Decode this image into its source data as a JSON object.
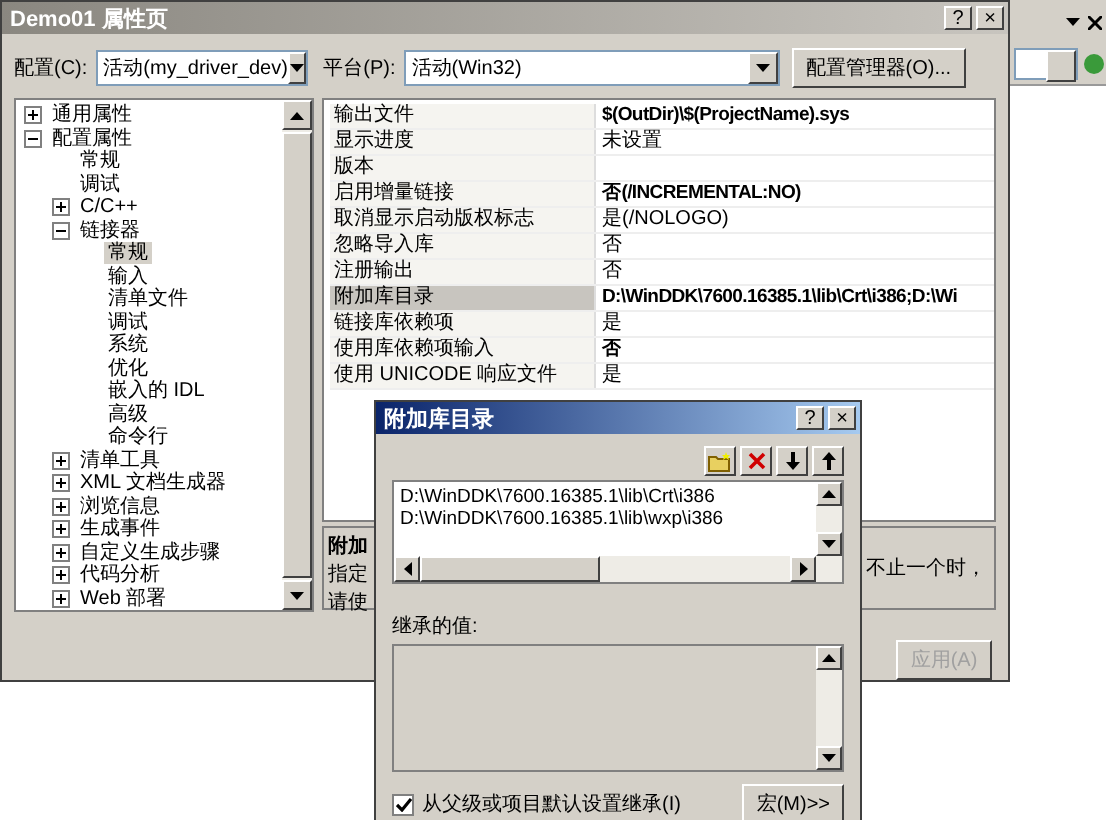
{
  "main_window": {
    "title": "Demo01 属性页",
    "help": "?",
    "close": "×",
    "config": {
      "label": "配置(C):",
      "value": "活动(my_driver_dev)"
    },
    "platform": {
      "label": "平台(P):",
      "value": "活动(Win32)"
    },
    "manager_button": "配置管理器(O)...",
    "tree": [
      {
        "label": "通用属性",
        "expanded": false,
        "selected": false
      },
      {
        "label": "配置属性",
        "expanded": true,
        "selected": false,
        "children": [
          {
            "label": "常规",
            "selected": false
          },
          {
            "label": "调试",
            "selected": false
          },
          {
            "label": "C/C++",
            "expanded": false,
            "selected": false
          },
          {
            "label": "链接器",
            "expanded": true,
            "selected": false,
            "children": [
              {
                "label": "常规",
                "selected": true
              },
              {
                "label": "输入",
                "selected": false
              },
              {
                "label": "清单文件",
                "selected": false
              },
              {
                "label": "调试",
                "selected": false
              },
              {
                "label": "系统",
                "selected": false
              },
              {
                "label": "优化",
                "selected": false
              },
              {
                "label": "嵌入的 IDL",
                "selected": false
              },
              {
                "label": "高级",
                "selected": false
              },
              {
                "label": "命令行",
                "selected": false
              }
            ]
          },
          {
            "label": "清单工具",
            "expanded": false,
            "selected": false
          },
          {
            "label": "XML 文档生成器",
            "expanded": false,
            "selected": false
          },
          {
            "label": "浏览信息",
            "expanded": false,
            "selected": false
          },
          {
            "label": "生成事件",
            "expanded": false,
            "selected": false
          },
          {
            "label": "自定义生成步骤",
            "expanded": false,
            "selected": false
          },
          {
            "label": "代码分析",
            "expanded": false,
            "selected": false
          },
          {
            "label": "Web 部署",
            "expanded": false,
            "selected": false
          }
        ]
      }
    ],
    "properties": [
      {
        "label": "输出文件",
        "value": "$(OutDir)\\$(ProjectName).sys",
        "modified": true,
        "selected": false
      },
      {
        "label": "显示进度",
        "value": "未设置",
        "modified": false,
        "selected": false
      },
      {
        "label": "版本",
        "selected": false
      },
      {
        "label": "启用增量链接",
        "value": "否(/INCREMENTAL:NO)",
        "modified": true,
        "selected": false
      },
      {
        "label": "取消显示启动版权标志",
        "value": "是(/NOLOGO)",
        "modified": false,
        "selected": false
      },
      {
        "label": "忽略导入库",
        "value": "否",
        "modified": false,
        "selected": false
      },
      {
        "label": "注册输出",
        "value": "否",
        "modified": false,
        "selected": false
      },
      {
        "label": "附加库目录",
        "value": "D:\\WinDDK\\7600.16385.1\\lib\\Crt\\i386;D:\\Wi",
        "modified": true,
        "selected": true
      },
      {
        "label": "链接库依赖项",
        "value": "是",
        "modified": false,
        "selected": false
      },
      {
        "label": "使用库依赖项输入",
        "value": "否",
        "modified": true,
        "selected": false
      },
      {
        "label": "使用 UNICODE 响应文件",
        "value": "是",
        "modified": false,
        "selected": false
      }
    ],
    "description": {
      "title": "附加",
      "lines": [
        "指定",
        "请使"
      ],
      "tail": "不止一个时，"
    },
    "apply_button": {
      "label": "应用(A)",
      "disabled": true
    }
  },
  "sub_dialog": {
    "title": "附加库目录",
    "help": "?",
    "close": "×",
    "directories": [
      "D:\\WinDDK\\7600.16385.1\\lib\\Crt\\i386",
      "D:\\WinDDK\\7600.16385.1\\lib\\wxp\\i386"
    ],
    "inherited_label": "继承的值:",
    "inherit": {
      "label": "从父级或项目默认设置继承(I)",
      "checked": true
    },
    "macro_button": "宏(M)>>"
  }
}
